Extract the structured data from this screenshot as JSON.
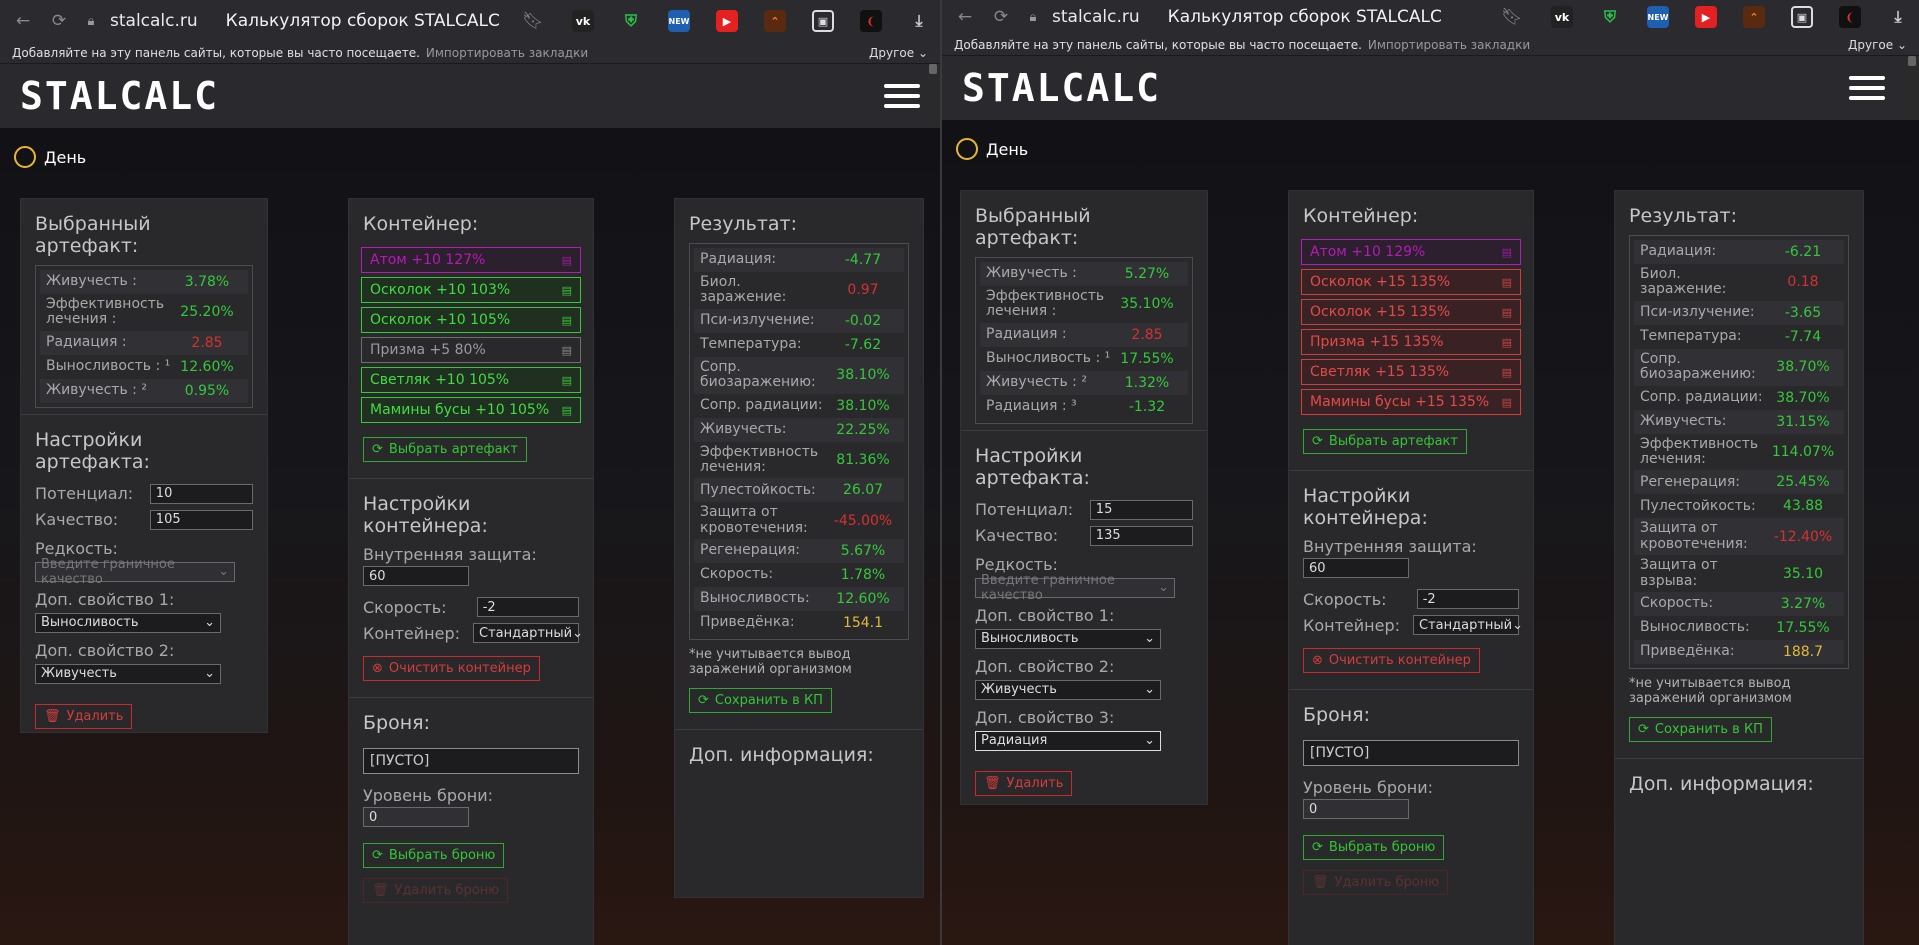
{
  "browser": {
    "url": "stalcalc.ru",
    "title": "Калькулятор сборок STALCALC",
    "bookmarks_hint": "Добавляйте на эту панель сайты, которые вы часто посещаете.",
    "import_bookmarks": "Импортировать закладки",
    "other": "Другое ⌄",
    "ext_new": "NEW"
  },
  "site": {
    "logo": "STALCALC",
    "mode": "День"
  },
  "labels": {
    "selected_artifact": "Выбранный артефакт:",
    "artifact_settings": "Настройки артефакта:",
    "potential": "Потенциал:",
    "quality": "Качество:",
    "rarity": "Редкость:",
    "rarity_placeholder": "Введите граничное качество",
    "extra1": "Доп. свойство 1:",
    "extra2": "Доп. свойство 2:",
    "extra3": "Доп. свойство 3:",
    "delete": "Удалить",
    "container": "Контейнер:",
    "choose_artifact": "Выбрать артефакт",
    "container_settings": "Настройки контейнера:",
    "inner_protection": "Внутренняя защита:",
    "speed": "Скорость:",
    "container_type": "Контейнер:",
    "clear_container": "Очистить контейнер",
    "armor": "Броня:",
    "armor_empty": "[ПУСТО]",
    "armor_level": "Уровень брони:",
    "choose_armor": "Выбрать броню",
    "delete_armor": "Удалить броню",
    "result": "Результат:",
    "note": "*не учитывается вывод заражений организмом",
    "save_kp": "Сохранить в КП",
    "extra_info": "Доп. информация:"
  },
  "left": {
    "artifact": [
      {
        "k": "Живучесть :",
        "v": "3.78%",
        "c": "g"
      },
      {
        "k": "Эффективность лечения :",
        "v": "25.20%",
        "c": "g"
      },
      {
        "k": "Радиация :",
        "v": "2.85",
        "c": "r"
      },
      {
        "k": "Выносливость : ¹",
        "v": "12.60%",
        "c": "g"
      },
      {
        "k": "Живучесть : ²",
        "v": "0.95%",
        "c": "g"
      }
    ],
    "potential": "10",
    "quality": "105",
    "extra1": "Выносливость",
    "extra2": "Живучесть",
    "container_items": [
      {
        "name": "Атом +10 127%",
        "c": "purple"
      },
      {
        "name": "Осколок +10 103%",
        "c": "green"
      },
      {
        "name": "Осколок +10 105%",
        "c": "green"
      },
      {
        "name": "Призма +5 80%",
        "c": "grey"
      },
      {
        "name": "Светляк +10 105%",
        "c": "green"
      },
      {
        "name": "Мамины бусы +10 105%",
        "c": "green"
      }
    ],
    "inner_protection": "60",
    "speed": "-2",
    "container_type": "Стандартный",
    "armor_level": "0",
    "result": [
      {
        "k": "Радиация:",
        "v": "-4.77",
        "c": "g"
      },
      {
        "k": "Биол. заражение:",
        "v": "0.97",
        "c": "r"
      },
      {
        "k": "Пси-излучение:",
        "v": "-0.02",
        "c": "g"
      },
      {
        "k": "Температура:",
        "v": "-7.62",
        "c": "g"
      },
      {
        "k": "Сопр. биозаражению:",
        "v": "38.10%",
        "c": "g"
      },
      {
        "k": "Сопр. радиации:",
        "v": "38.10%",
        "c": "g"
      },
      {
        "k": "Живучесть:",
        "v": "22.25%",
        "c": "g"
      },
      {
        "k": "Эффективность лечения:",
        "v": "81.36%",
        "c": "g"
      },
      {
        "k": "Пулестойкость:",
        "v": "26.07",
        "c": "g"
      },
      {
        "k": "Защита от кровотечения:",
        "v": "-45.00%",
        "c": "r"
      },
      {
        "k": "Регенерация:",
        "v": "5.67%",
        "c": "g"
      },
      {
        "k": "Скорость:",
        "v": "1.78%",
        "c": "g"
      },
      {
        "k": "Выносливость:",
        "v": "12.60%",
        "c": "g"
      },
      {
        "k": "Приведёнка:",
        "v": "154.1",
        "c": "y"
      }
    ]
  },
  "right": {
    "artifact": [
      {
        "k": "Живучесть :",
        "v": "5.27%",
        "c": "g"
      },
      {
        "k": "Эффективность лечения :",
        "v": "35.10%",
        "c": "g"
      },
      {
        "k": "Радиация :",
        "v": "2.85",
        "c": "r"
      },
      {
        "k": "Выносливость : ¹",
        "v": "17.55%",
        "c": "g"
      },
      {
        "k": "Живучесть : ²",
        "v": "1.32%",
        "c": "g"
      },
      {
        "k": "Радиация : ³",
        "v": "-1.32",
        "c": "g"
      }
    ],
    "potential": "15",
    "quality": "135",
    "extra1": "Выносливость",
    "extra2": "Живучесть",
    "extra3": "Радиация",
    "container_items": [
      {
        "name": "Атом +10 129%",
        "c": "purple"
      },
      {
        "name": "Осколок +15 135%",
        "c": "red"
      },
      {
        "name": "Осколок +15 135%",
        "c": "red"
      },
      {
        "name": "Призма +15 135%",
        "c": "red"
      },
      {
        "name": "Светляк +15 135%",
        "c": "red"
      },
      {
        "name": "Мамины бусы +15 135%",
        "c": "red"
      }
    ],
    "inner_protection": "60",
    "speed": "-2",
    "container_type": "Стандартный",
    "armor_level": "0",
    "result": [
      {
        "k": "Радиация:",
        "v": "-6.21",
        "c": "g"
      },
      {
        "k": "Биол. заражение:",
        "v": "0.18",
        "c": "r"
      },
      {
        "k": "Пси-излучение:",
        "v": "-3.65",
        "c": "g"
      },
      {
        "k": "Температура:",
        "v": "-7.74",
        "c": "g"
      },
      {
        "k": "Сопр. биозаражению:",
        "v": "38.70%",
        "c": "g"
      },
      {
        "k": "Сопр. радиации:",
        "v": "38.70%",
        "c": "g"
      },
      {
        "k": "Живучесть:",
        "v": "31.15%",
        "c": "g"
      },
      {
        "k": "Эффективность лечения:",
        "v": "114.07%",
        "c": "g"
      },
      {
        "k": "Регенерация:",
        "v": "25.45%",
        "c": "g"
      },
      {
        "k": "Пулестойкость:",
        "v": "43.88",
        "c": "g"
      },
      {
        "k": "Защита от кровотечения:",
        "v": "-12.40%",
        "c": "r"
      },
      {
        "k": "Защита от взрыва:",
        "v": "35.10",
        "c": "g"
      },
      {
        "k": "Скорость:",
        "v": "3.27%",
        "c": "g"
      },
      {
        "k": "Выносливость:",
        "v": "17.55%",
        "c": "g"
      },
      {
        "k": "Приведёнка:",
        "v": "188.7",
        "c": "y"
      }
    ]
  }
}
